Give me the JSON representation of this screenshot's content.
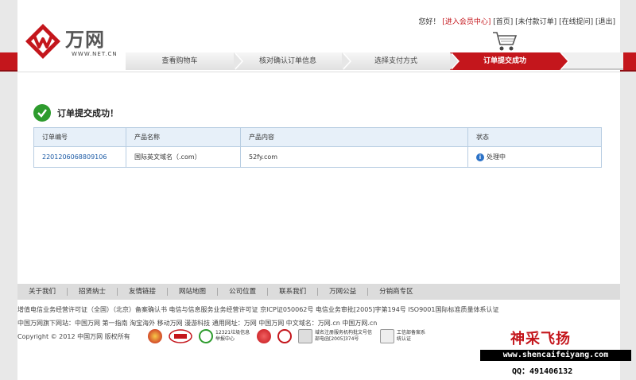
{
  "brand": {
    "name": "万网",
    "domain": "WWW.NET.CN"
  },
  "toplinks": {
    "greeting": "您好！",
    "member": "[进入会员中心]",
    "home": "[首页]",
    "unpaid": "[未付款订单]",
    "ask": "[在线提问]",
    "logout": "[退出]"
  },
  "steps": [
    "查看购物车",
    "核对确认订单信息",
    "选择支付方式",
    "订单提交成功"
  ],
  "success": {
    "title": "订单提交成功！"
  },
  "table": {
    "headers": [
      "订单编号",
      "产品名称",
      "产品内容",
      "状态"
    ],
    "rows": [
      {
        "order_id": "2201206068809106",
        "product": "国际英文域名（.com）",
        "content": "52fy.com",
        "status": "处理中"
      }
    ]
  },
  "footer": {
    "nav": [
      "关于我们",
      "招贤纳士",
      "友情链接",
      "网站地图",
      "公司位置",
      "联系我们",
      "万网公益",
      "分销商专区"
    ],
    "line1": "增值电信业务经营许可证（全国）（北京）备案确认书  电信与信息服务业务经营许可证 京ICP证050062号  电信业务审批[2005]字第194号  ISO9001国际标准质量体系认证",
    "line2": "中国万网旗下网站：中国万网  第一指南  淘宝海外  移动万网  漫游科技  通用网址：万网  中国万网  中文域名：万网.cn  中国万网.cn",
    "copyright": "Copyright © 2012 中国万网 版权所有",
    "badges": [
      "12321垃圾信息举报中心",
      "域名注册服务机构批文号信部电函[2005]374号",
      "工信部备案系统认证"
    ]
  },
  "watermark": {
    "title": "神采飞扬",
    "url": "www.shencaifeiyang.com",
    "qq": "QQ：491406132"
  },
  "colors": {
    "brand_red": "#c4161c",
    "link_blue": "#1b5aa5",
    "table_header": "#e7f0f9",
    "success_green": "#2d9b2d"
  }
}
